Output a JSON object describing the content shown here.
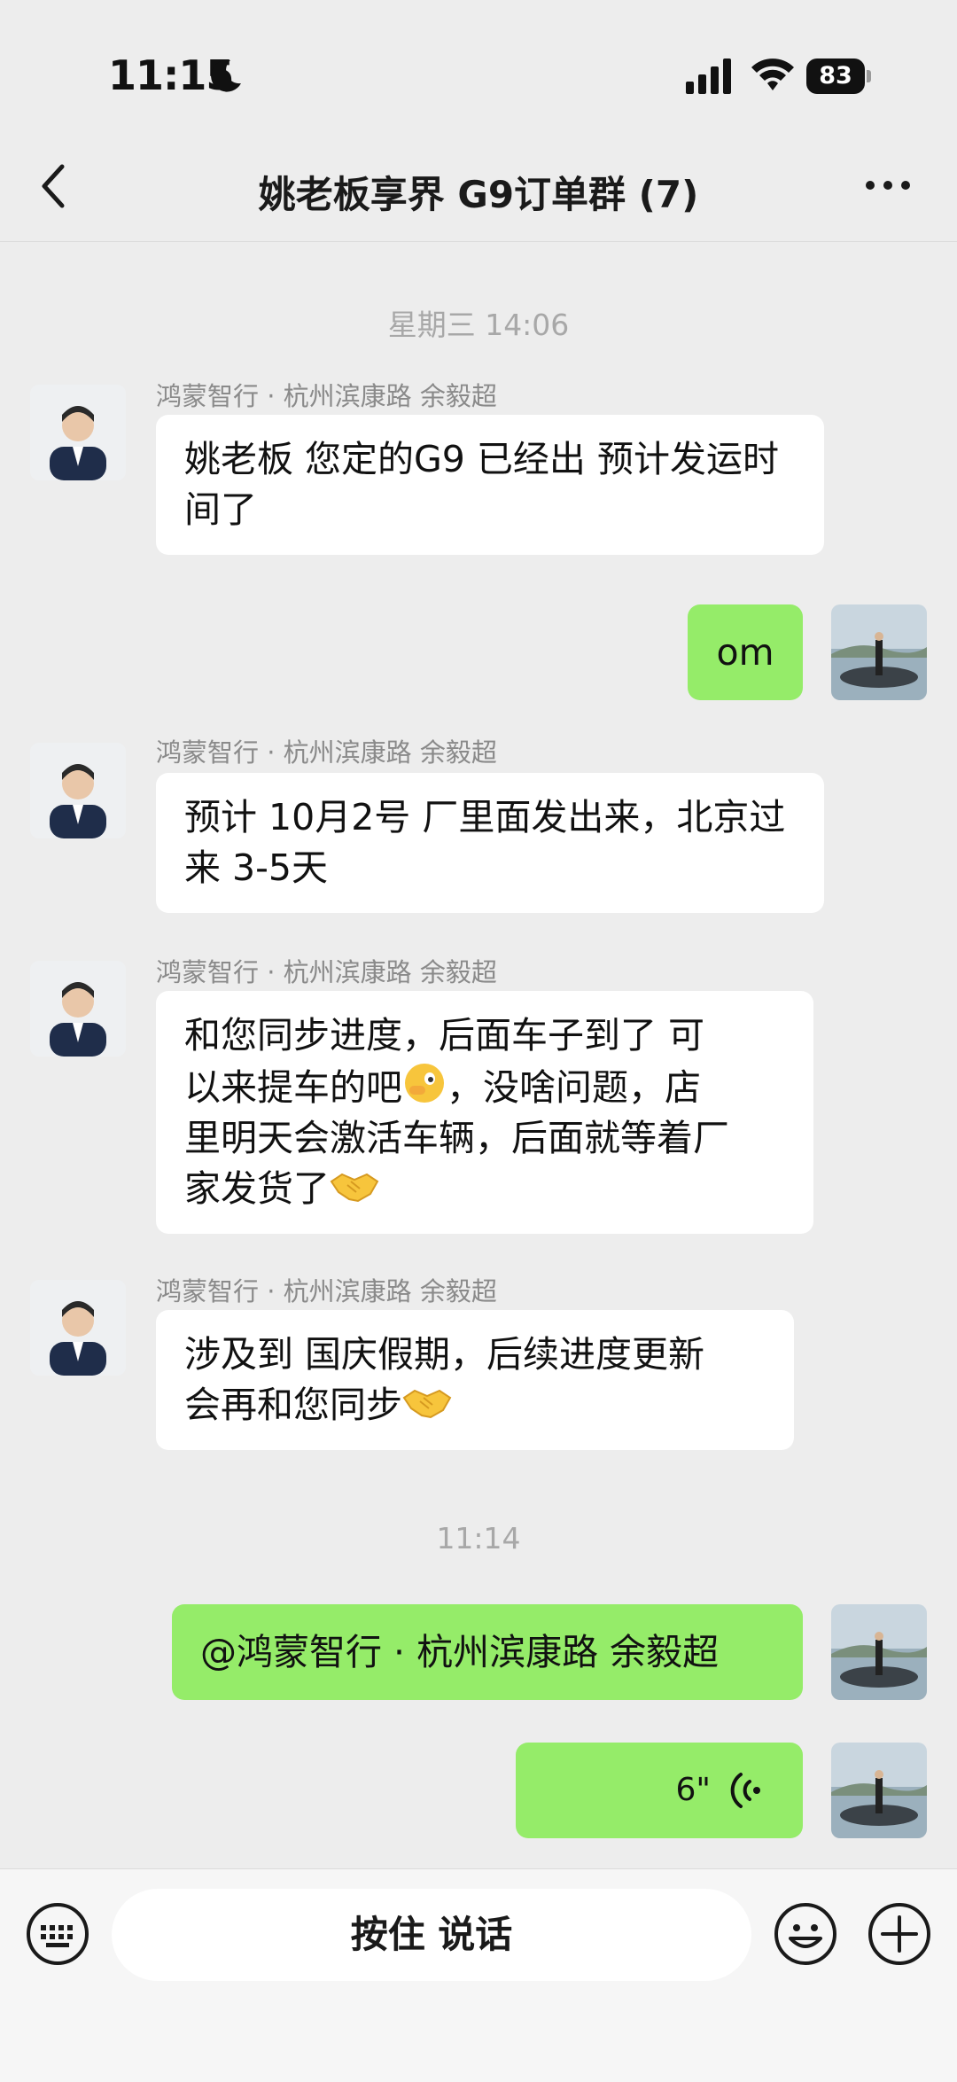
{
  "status_bar": {
    "time": "11:15",
    "battery": "83"
  },
  "header": {
    "title": "姚老板享界 G9订单群 (7)"
  },
  "timestamps": [
    "星期三 14:06",
    "11:14"
  ],
  "messages": [
    {
      "side": "in",
      "sender": "鸿蒙智行 · 杭州滨康路 余毅超",
      "text": "姚老板 您定的G9 已经出 预计发运时间了"
    },
    {
      "side": "out",
      "text": "om"
    },
    {
      "side": "in",
      "sender": "鸿蒙智行 · 杭州滨康路 余毅超",
      "text": "预计 10月2号 厂里面发出来，北京过来 3-5天"
    },
    {
      "side": "in",
      "sender": "鸿蒙智行 · 杭州滨康路 余毅超",
      "line1": "和您同步进度，后面车子到了 可",
      "line2a": "以来提车的吧",
      "line2b": "，没啥问题，店",
      "line3": "里明天会激活车辆，后面就等着厂",
      "line4": "家发货了"
    },
    {
      "side": "in",
      "sender": "鸿蒙智行 · 杭州滨康路 余毅超",
      "line1": "涉及到 国庆假期，后续进度更新",
      "line2": "会再和您同步"
    },
    {
      "side": "out",
      "text": "@鸿蒙智行 · 杭州滨康路 余毅超"
    },
    {
      "side": "out",
      "voice_duration": "6\""
    }
  ],
  "input_bar": {
    "talk_label": "按住 说话"
  },
  "colors": {
    "background": "#ededed",
    "incoming_bubble": "#ffffff",
    "outgoing_bubble": "#95ec69"
  },
  "icons": [
    "moon-icon",
    "signal-icon",
    "wifi-icon",
    "back-icon",
    "more-icon",
    "keyboard-icon",
    "emoji-icon",
    "plus-icon",
    "voice-wave-icon",
    "peek-emoji-icon",
    "handshake-emoji-icon"
  ]
}
